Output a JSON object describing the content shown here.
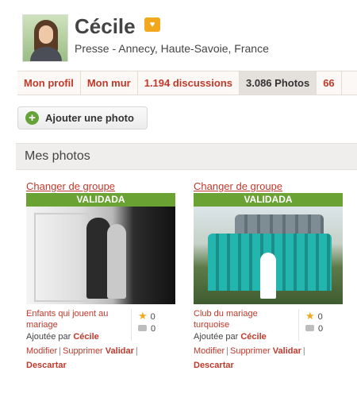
{
  "profile": {
    "name": "Cécile",
    "subtitle": "Presse - Annecy, Haute-Savoie, France"
  },
  "tabs": [
    {
      "label": "Mon profil",
      "active": false
    },
    {
      "label": "Mon mur",
      "active": false
    },
    {
      "label": "1.194 discussions",
      "active": false
    },
    {
      "label": "3.086 Photos",
      "active": true
    },
    {
      "label": "66",
      "active": false
    }
  ],
  "actions": {
    "add_photo": "Ajouter une photo"
  },
  "section": {
    "title": "Mes photos"
  },
  "photos": [
    {
      "change_group": "Changer de groupe",
      "status": "VALIDADA",
      "title": "Enfants qui jouent au mariage",
      "added_prefix": "Ajoutée par",
      "author": "Cécile",
      "stars": "0",
      "comments": "0",
      "edit": "Modifier",
      "delete": "Supprimer",
      "validate": "Validar",
      "discard": "Descartar"
    },
    {
      "change_group": "Changer de groupe",
      "status": "VALIDADA",
      "title": "Club du mariage turquoise",
      "added_prefix": "Ajoutée par",
      "author": "Cécile",
      "stars": "0",
      "comments": "0",
      "edit": "Modifier",
      "delete": "Supprimer",
      "validate": "Validar",
      "discard": "Descartar"
    }
  ],
  "colors": {
    "link": "#c0392b",
    "status_green": "#6aa334",
    "badge": "#f2a81d"
  },
  "icons": {
    "badge": "heart-badge-icon",
    "add": "plus-circle-icon",
    "star": "star-icon",
    "comment": "comment-icon"
  }
}
